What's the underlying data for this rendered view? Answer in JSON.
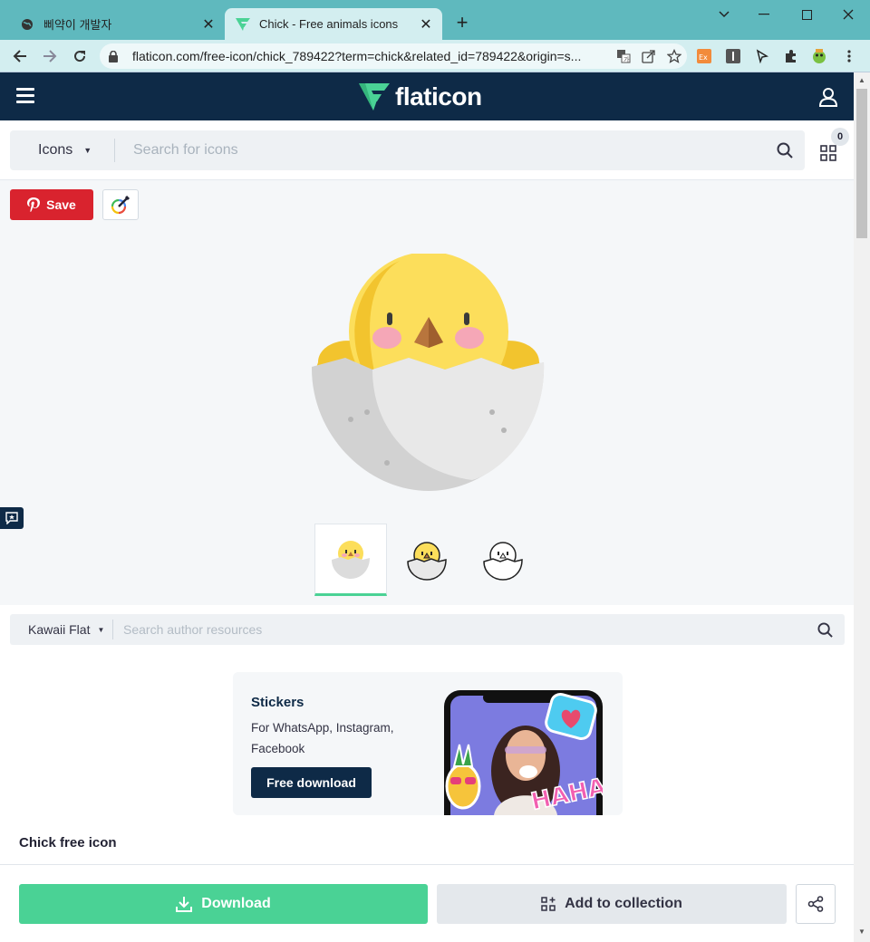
{
  "browser": {
    "tabs": [
      {
        "title": "삐약이 개발자",
        "icon": "globe-icon"
      },
      {
        "title": "Chick - Free animals icons",
        "icon": "flaticon-favicon"
      }
    ],
    "url": "flaticon.com/free-icon/chick_789422?term=chick&related_id=789422&origin=s..."
  },
  "header": {
    "logo_text": "flaticon"
  },
  "search": {
    "type_label": "Icons",
    "placeholder": "Search for icons",
    "collection_count": "0"
  },
  "actions": {
    "save_label": "Save"
  },
  "author_search": {
    "style_label": "Kawaii Flat",
    "placeholder": "Search author resources"
  },
  "ad": {
    "title": "Stickers",
    "text": "For WhatsApp, Instagram, Facebook",
    "button_label": "Free download",
    "sticker_text": "HAHA"
  },
  "icon": {
    "title": "Chick free icon"
  },
  "footer": {
    "download_label": "Download",
    "collection_label": "Add to collection"
  },
  "colors": {
    "brand_dark": "#0e2a47",
    "brand_green": "#4ad295",
    "pinterest_red": "#d9232e"
  }
}
